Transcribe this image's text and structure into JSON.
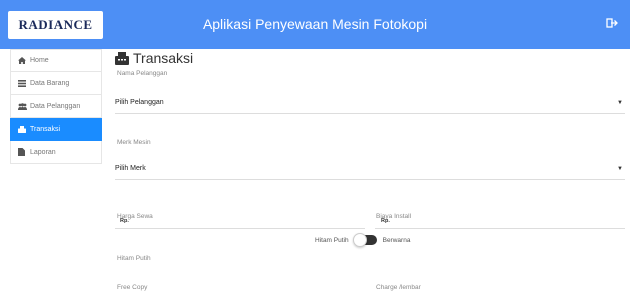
{
  "header": {
    "logo_text": "RADIANCE",
    "title": "Aplikasi Penyewaan Mesin Fotokopi",
    "logout_icon": "sign-out-icon"
  },
  "sidebar": {
    "items": [
      {
        "label": "Home",
        "icon": "home-icon"
      },
      {
        "label": "Data Barang",
        "icon": "list-icon"
      },
      {
        "label": "Data Pelanggan",
        "icon": "users-icon"
      },
      {
        "label": "Transaksi",
        "icon": "fax-icon",
        "active": true
      },
      {
        "label": "Laporan",
        "icon": "file-icon"
      }
    ]
  },
  "main": {
    "title": "Transaksi",
    "title_icon": "fax-icon",
    "nama_pelanggan": {
      "label": "Nama Pelanggan",
      "value": "Pilih Pelanggan"
    },
    "merk_mesin": {
      "label": "Merk Mesin",
      "value": "Pilih Merk"
    },
    "harga_sewa": {
      "label": "Harga Sewa",
      "prefix": "Rp."
    },
    "biaya_install": {
      "label": "Biaya Install",
      "prefix": "Rp."
    },
    "toggle": {
      "left_label": "Hitam Putih",
      "right_label": "Berwarna"
    },
    "hitam_putih_label": "Hitam Putih",
    "free_copy_label": "Free Copy",
    "charge_label": "Charge /lembar"
  },
  "colors": {
    "header": "#4d8ff5",
    "active": "#1a8cff"
  }
}
